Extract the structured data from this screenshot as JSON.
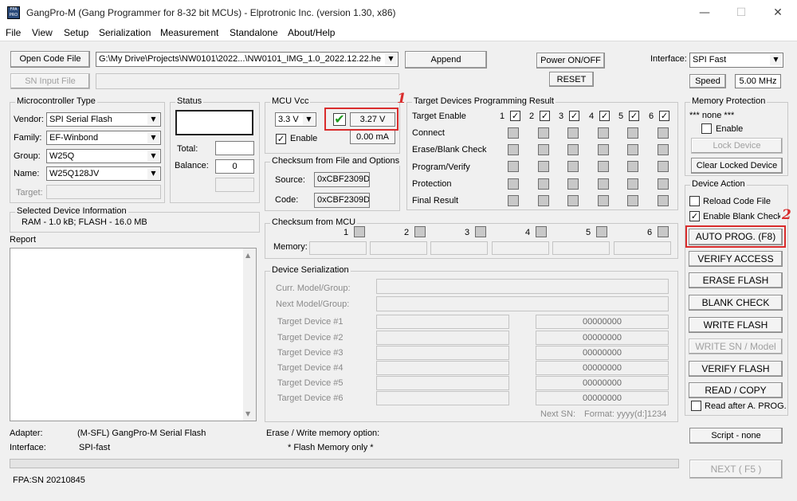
{
  "window": {
    "title": "GangPro-M (Gang Programmer for 8-32 bit MCUs)  -  Elprotronic Inc. (version 1.30, x86)",
    "icon": "gangpro-app-icon",
    "icon_text": "FPA PRO",
    "minimize": "—",
    "maximize": "☐",
    "close": "✕"
  },
  "menu": [
    "File",
    "View",
    "Setup",
    "Serialization",
    "Measurement",
    "Standalone",
    "About/Help"
  ],
  "toolbar": {
    "open_code_file": "Open Code File",
    "code_file_path": "G:\\My Drive\\Projects\\NW0101\\2022...\\NW0101_IMG_1.0_2022.12.22.he",
    "append": "Append",
    "sn_input_file": "SN Input File",
    "power_on_off": "Power ON/OFF",
    "reset": "RESET",
    "interface_label": "Interface:",
    "interface_value": "SPI Fast",
    "speed_button": "Speed",
    "speed_value": "5.00 MHz"
  },
  "mcu_type": {
    "title": "Microcontroller Type",
    "vendor_label": "Vendor:",
    "vendor": "SPI Serial Flash",
    "family_label": "Family:",
    "family": "EF-Winbond",
    "group_label": "Group:",
    "group": "W25Q",
    "name_label": "Name:",
    "name": "W25Q128JV",
    "target_label": "Target:"
  },
  "status": {
    "title": "Status",
    "total_label": "Total:",
    "balance_label": "Balance:",
    "balance": "0"
  },
  "mcu_vcc": {
    "title": "MCU Vcc",
    "voltage": "3.3 V",
    "measured_voltage": "3.27 V",
    "current": "0.00 mA",
    "enable_label": "Enable"
  },
  "checksum_file": {
    "title": "Checksum from File and Options",
    "source_label": "Source:",
    "source": "0xCBF2309D",
    "code_label": "Code:",
    "code": "0xCBF2309D"
  },
  "target_results": {
    "title": "Target Devices Programming Result",
    "enable_label": "Target Enable",
    "targets": [
      "1",
      "2",
      "3",
      "4",
      "5",
      "6"
    ],
    "rows": [
      "Connect",
      "Erase/Blank Check",
      "Program/Verify",
      "Protection",
      "Final Result"
    ]
  },
  "selected_device": {
    "title": "Selected Device Information",
    "info": "RAM -    1.0 kB;   FLASH - 16.0 MB"
  },
  "report": {
    "title": "Report"
  },
  "checksum_mcu": {
    "title": "Checksum from MCU",
    "memory_label": "Memory:",
    "targets": [
      "1",
      "2",
      "3",
      "4",
      "5",
      "6"
    ]
  },
  "serialization": {
    "title": "Device Serialization",
    "curr_label": "Curr. Model/Group:",
    "next_label": "Next Model/Group:",
    "targets": [
      {
        "label": "Target Device #1",
        "sn": "00000000"
      },
      {
        "label": "Target Device #2",
        "sn": "00000000"
      },
      {
        "label": "Target Device #3",
        "sn": "00000000"
      },
      {
        "label": "Target Device #4",
        "sn": "00000000"
      },
      {
        "label": "Target Device #5",
        "sn": "00000000"
      },
      {
        "label": "Target Device #6",
        "sn": "00000000"
      }
    ],
    "next_sn_label": "Next SN:",
    "format": "Format: yyyy(d:]1234"
  },
  "memory_protection": {
    "title": "Memory Protection",
    "status": "*** none ***",
    "enable_label": "Enable",
    "lock_device": "Lock Device",
    "clear_locked": "Clear Locked Device"
  },
  "device_action": {
    "title": "Device Action",
    "reload_code_file": "Reload Code File",
    "enable_blank_check": "Enable Blank Check",
    "auto_prog": "AUTO PROG. (F8)",
    "verify_access": "VERIFY ACCESS",
    "erase_flash": "ERASE FLASH",
    "blank_check": "BLANK CHECK",
    "write_flash": "WRITE FLASH",
    "write_sn": "WRITE SN / Model",
    "verify_flash": "VERIFY FLASH",
    "read_copy": "READ / COPY",
    "read_after": "Read after A. PROG."
  },
  "footer": {
    "adapter_label": "Adapter:",
    "adapter": "(M-SFL)   GangPro-M Serial Flash",
    "interface_label": "Interface:",
    "interface": "SPI-fast",
    "erase_write_label": "Erase / Write memory option:",
    "erase_write_value": "* Flash Memory only *",
    "script": "Script - none",
    "next": "NEXT  ( F5 )",
    "fpa_sn": "FPA:SN 20210845"
  },
  "annotations": {
    "one": "1",
    "two": "2"
  },
  "colors": {
    "annotation_red": "#d92c2c",
    "check_green": "#1e9a1e"
  }
}
